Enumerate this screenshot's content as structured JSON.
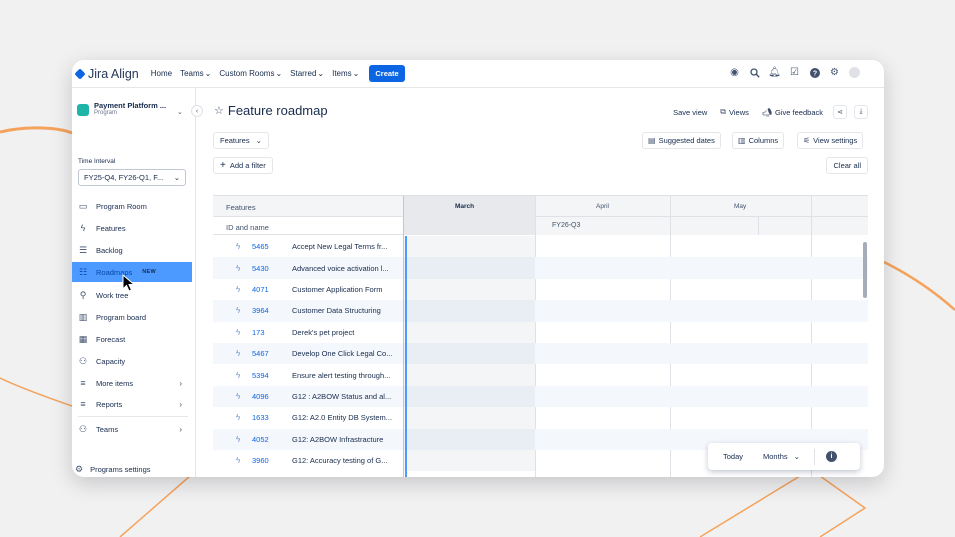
{
  "colors": {
    "accent": "#0c66e4",
    "active_item": "#4c9aff",
    "background_lines": "#f5a35c"
  },
  "topnav": {
    "logo": "Jira Align",
    "items": [
      {
        "label": "Home",
        "dropdown": false
      },
      {
        "label": "Teams",
        "dropdown": true
      },
      {
        "label": "Custom Rooms",
        "dropdown": true
      },
      {
        "label": "Starred",
        "dropdown": true
      },
      {
        "label": "Items",
        "dropdown": true
      }
    ],
    "create_label": "Create",
    "icons": [
      "profile-icon",
      "search-icon",
      "notification-icon",
      "checklist-icon",
      "help-icon",
      "settings-icon",
      "avatar"
    ]
  },
  "sidebar": {
    "program_name": "Payment Platform ...",
    "program_type": "Program",
    "time_interval_label": "Time Interval",
    "time_interval_value": "FY25-Q4, FY26-Q1, F...",
    "items": [
      {
        "label": "Program Room",
        "icon": "room-icon"
      },
      {
        "label": "Features",
        "icon": "lightning-icon"
      },
      {
        "label": "Backlog",
        "icon": "backlog-icon"
      },
      {
        "label": "Roadmaps",
        "icon": "roadmap-icon",
        "badge": "NEW",
        "active": true
      },
      {
        "label": "Work tree",
        "icon": "tree-icon"
      },
      {
        "label": "Program board",
        "icon": "board-icon"
      },
      {
        "label": "Forecast",
        "icon": "forecast-icon"
      },
      {
        "label": "Capacity",
        "icon": "capacity-icon"
      },
      {
        "label": "More items",
        "icon": "list-icon",
        "chevron": true
      },
      {
        "label": "Reports",
        "icon": "list-icon",
        "chevron": true
      },
      {
        "label": "Teams",
        "icon": "teams-icon",
        "chevron": true
      }
    ],
    "footer_label": "Programs settings"
  },
  "main": {
    "title": "Feature roadmap",
    "toolbar": {
      "save_view": "Save view",
      "views": "Views",
      "give_feedback": "Give feedback"
    },
    "features_dropdown": "Features",
    "add_filter": "Add a filter",
    "suggested_dates": "Suggested dates",
    "columns": "Columns",
    "view_settings": "View settings",
    "clear_all": "Clear all"
  },
  "grid": {
    "header_features": "Features",
    "header_id_name": "ID and name",
    "months": [
      "March",
      "April",
      "May"
    ],
    "quarter": "FY26-Q3",
    "rows": [
      {
        "id": "5465",
        "name": "Accept New Legal Terms fr..."
      },
      {
        "id": "5430",
        "name": "Advanced voice activation l..."
      },
      {
        "id": "4071",
        "name": "Customer Application Form"
      },
      {
        "id": "3964",
        "name": "Customer Data Structuring"
      },
      {
        "id": "173",
        "name": "Derek's pet project"
      },
      {
        "id": "5467",
        "name": "Develop One Click Legal Co..."
      },
      {
        "id": "5394",
        "name": "Ensure alert testing through..."
      },
      {
        "id": "4096",
        "name": "G12 : A2BOW Status and al..."
      },
      {
        "id": "1633",
        "name": "G12: A2.0 Entity DB System..."
      },
      {
        "id": "4052",
        "name": "G12: A2BOW Infrastracture"
      },
      {
        "id": "3960",
        "name": "G12: Accuracy testing of G..."
      }
    ]
  },
  "view_control": {
    "today": "Today",
    "scale": "Months"
  }
}
